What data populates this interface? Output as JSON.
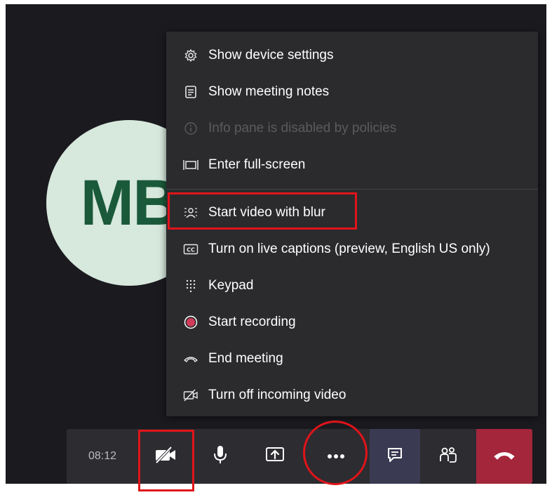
{
  "avatar": {
    "initials": "MB"
  },
  "menu": {
    "items": [
      {
        "label": "Show device settings",
        "icon": "gear-icon",
        "disabled": false
      },
      {
        "label": "Show meeting notes",
        "icon": "notes-icon",
        "disabled": false
      },
      {
        "label": "Info pane is disabled by policies",
        "icon": "info-icon",
        "disabled": true
      },
      {
        "label": "Enter full-screen",
        "icon": "fullscreen-icon",
        "disabled": false
      },
      {
        "label": "Start video with blur",
        "icon": "blur-icon",
        "disabled": false
      },
      {
        "label": "Turn on live captions (preview, English US only)",
        "icon": "captions-icon",
        "disabled": false
      },
      {
        "label": "Keypad",
        "icon": "keypad-icon",
        "disabled": false
      },
      {
        "label": "Start recording",
        "icon": "record-icon",
        "disabled": false
      },
      {
        "label": "End meeting",
        "icon": "end-call-icon",
        "disabled": false
      },
      {
        "label": "Turn off incoming video",
        "icon": "video-off-icon",
        "disabled": false
      }
    ]
  },
  "toolbar": {
    "timer": "08:12",
    "buttons": [
      "camera-off-icon",
      "microphone-icon",
      "share-screen-icon",
      "more-options-icon",
      "chat-icon",
      "participants-icon",
      "hang-up-icon"
    ]
  },
  "colors": {
    "highlight": "#e0141a",
    "hangup": "#a4263b",
    "avatar_bg": "#d7e8dd",
    "avatar_text": "#1a5a3a"
  }
}
